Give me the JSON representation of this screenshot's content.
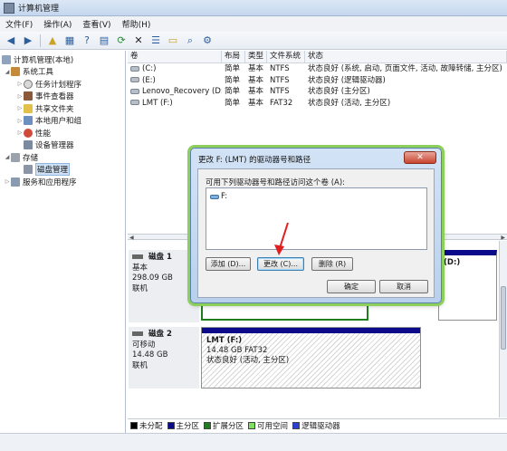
{
  "window": {
    "title": "计算机管理"
  },
  "menu": [
    "文件(F)",
    "操作(A)",
    "查看(V)",
    "帮助(H)"
  ],
  "toolbar": [
    "back-icon",
    "forward-icon",
    "up-folder-icon",
    "show-hide-tree-icon",
    "help-icon",
    "properties-icon",
    "refresh-icon",
    "delete-icon",
    "properties-sheet-icon",
    "open-folder-icon",
    "search-icon",
    "settings-icon"
  ],
  "tree": [
    {
      "label": "计算机管理(本地)",
      "level": 0,
      "arrow": ""
    },
    {
      "label": "系统工具",
      "level": 1,
      "arrow": "◢"
    },
    {
      "label": "任务计划程序",
      "level": 2,
      "arrow": "▷"
    },
    {
      "label": "事件查看器",
      "level": 2,
      "arrow": "▷"
    },
    {
      "label": "共享文件夹",
      "level": 2,
      "arrow": "▷"
    },
    {
      "label": "本地用户和组",
      "level": 2,
      "arrow": "▷"
    },
    {
      "label": "性能",
      "level": 2,
      "arrow": "▷"
    },
    {
      "label": "设备管理器",
      "level": 2,
      "arrow": ""
    },
    {
      "label": "存储",
      "level": 1,
      "arrow": "◢"
    },
    {
      "label": "磁盘管理",
      "level": 2,
      "arrow": ""
    },
    {
      "label": "服务和应用程序",
      "level": 1,
      "arrow": "▷"
    }
  ],
  "volumes": {
    "headers": [
      "卷",
      "布局",
      "类型",
      "文件系统",
      "状态"
    ],
    "rows": [
      [
        "(C:)",
        "简单",
        "基本",
        "NTFS",
        "状态良好 (系统, 启动, 页面文件, 活动, 故障转储, 主分区)"
      ],
      [
        "(E:)",
        "简单",
        "基本",
        "NTFS",
        "状态良好 (逻辑驱动器)"
      ],
      [
        "Lenovo_Recovery (D:)",
        "简单",
        "基本",
        "NTFS",
        "状态良好 (主分区)"
      ],
      [
        "LMT (F:)",
        "简单",
        "基本",
        "FAT32",
        "状态良好 (活动, 主分区)"
      ]
    ]
  },
  "disks": [
    {
      "name": "磁盘 1",
      "type": "基本",
      "size": "298.09 GB",
      "status": "联机",
      "partition_label": "(D:)"
    },
    {
      "name": "磁盘 2",
      "type": "可移动",
      "size": "14.48 GB",
      "status": "联机",
      "partition": {
        "name": "LMT  (F:)",
        "detail": "14.48 GB FAT32",
        "status": "状态良好 (活动, 主分区)"
      }
    }
  ],
  "legend": [
    {
      "label": "未分配",
      "color": "#000000"
    },
    {
      "label": "主分区",
      "color": "#0a0a8a"
    },
    {
      "label": "扩展分区",
      "color": "#1f7f1f"
    },
    {
      "label": "可用空间",
      "color": "#7ee060"
    },
    {
      "label": "逻辑驱动器",
      "color": "#2a3fd6"
    }
  ],
  "dialog": {
    "title": "更改 F: (LMT) 的驱动器号和路径",
    "close": "✕",
    "prompt": "可用下列驱动器号和路径访问这个卷 (A):",
    "list_item": "F:",
    "buttons": {
      "add": "添加 (D)...",
      "change": "更改 (C)...",
      "remove": "删除 (R)",
      "ok": "确定",
      "cancel": "取消"
    }
  }
}
